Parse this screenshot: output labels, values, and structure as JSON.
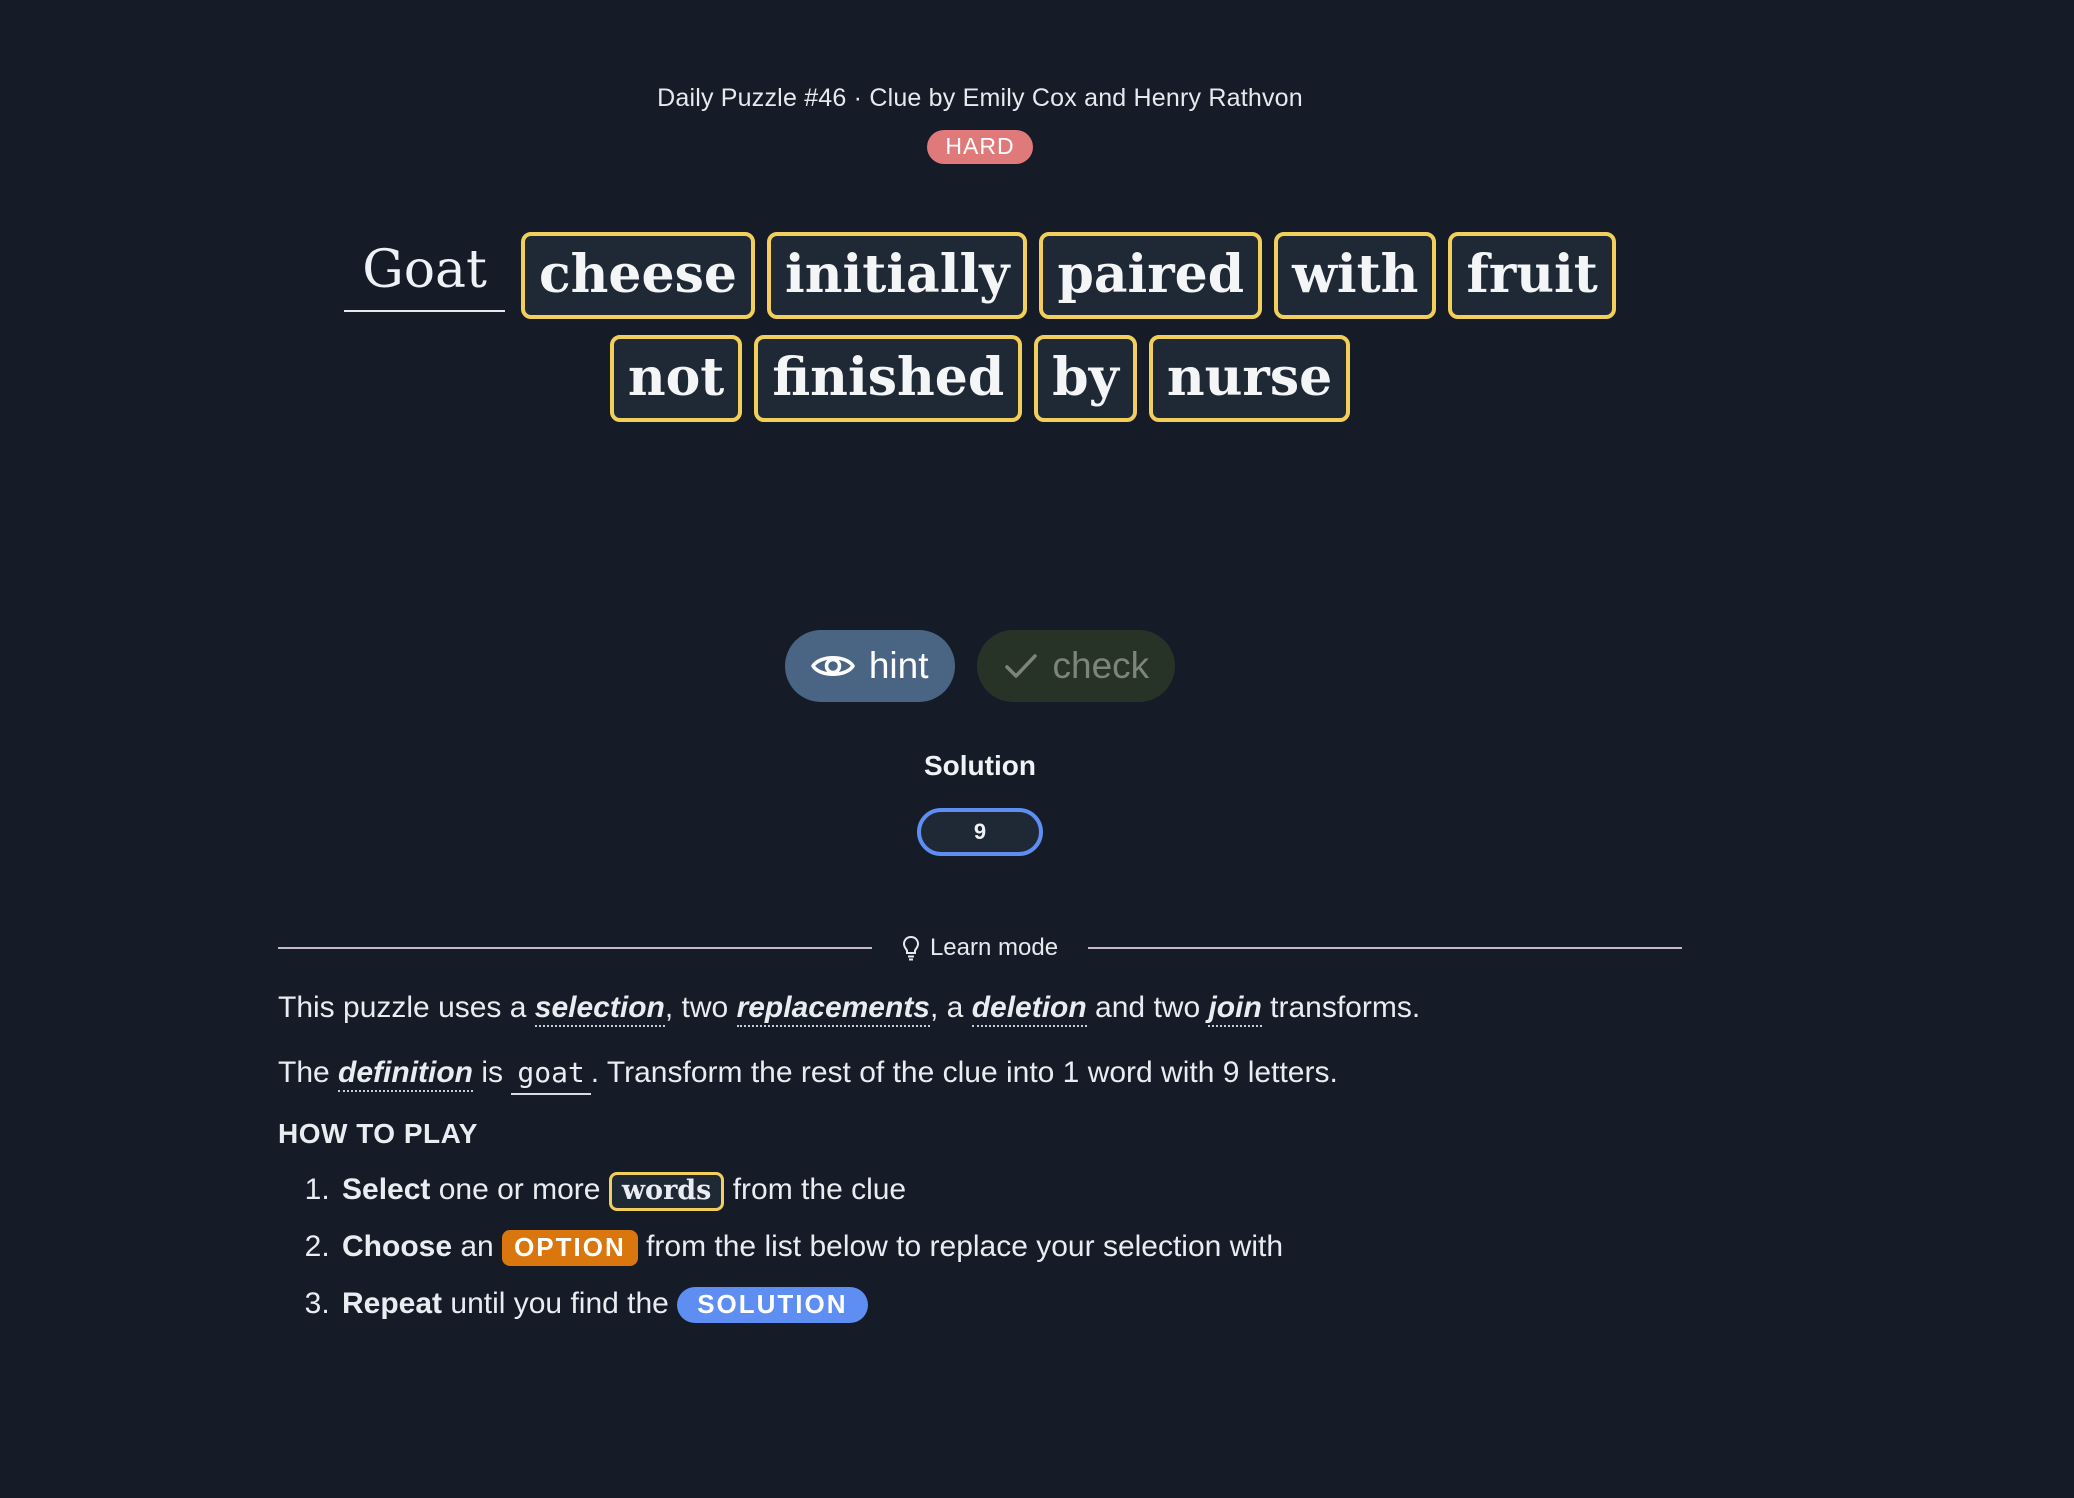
{
  "header": {
    "title": "Daily Puzzle #46 · Clue by Emily Cox and Henry Rathvon",
    "difficulty": "HARD"
  },
  "clue": {
    "definition": "Goat",
    "words": [
      "cheese",
      "initially",
      "paired",
      "with",
      "fruit",
      "not",
      "finished",
      "by",
      "nurse"
    ]
  },
  "buttons": {
    "hint_label": "hint",
    "check_label": "check"
  },
  "solution": {
    "label": "Solution",
    "length": "9"
  },
  "learn": {
    "divider_label": "Learn mode",
    "line1": {
      "t1": "This puzzle uses a ",
      "term1": "selection",
      "t2": ", two ",
      "term2": "replacements",
      "t3": ", a ",
      "term3": "deletion",
      "t4": " and two ",
      "term4": "join",
      "t5": " transforms."
    },
    "line2": {
      "t1": "The ",
      "term": "definition",
      "t2": " is ",
      "def_word": "goat",
      "t3": ". Transform the rest of the clue into 1 word with 9 letters."
    },
    "howto_title": "HOW TO PLAY",
    "steps": [
      {
        "bold": "Select",
        "pre": " one or more ",
        "tag": "words",
        "post": " from the clue"
      },
      {
        "bold": "Choose",
        "pre": " an ",
        "tag": "OPTION",
        "post": " from the list below to replace your selection with"
      },
      {
        "bold": "Repeat",
        "pre": " until you find the ",
        "tag": "SOLUTION",
        "post": ""
      }
    ]
  },
  "colors": {
    "background": "#161c27",
    "word_border": "#f2cf5b",
    "hard_badge": "#e07a7a",
    "hint_button": "#4a6584",
    "check_button": "#263326",
    "solution_border": "#5e8ef2",
    "option_tag": "#d9770e"
  },
  "icons": {
    "hint": "eye-icon",
    "check": "checkmark-icon",
    "learn": "lightbulb-icon"
  }
}
